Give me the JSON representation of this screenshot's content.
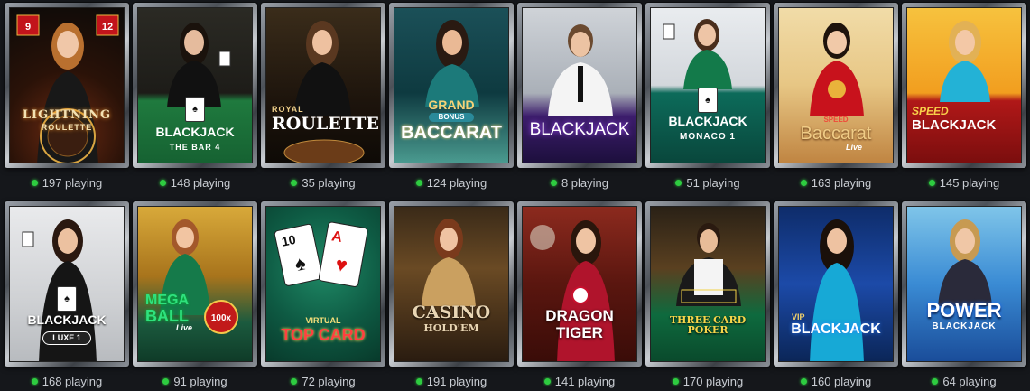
{
  "colors": {
    "page_bg": "#15171b",
    "status_dot": "#2ecc40",
    "count_text": "#c9cdd3"
  },
  "games": [
    {
      "logo": [
        "LIGHTNING",
        "ROULETTE",
        ""
      ],
      "playing": "197 playing",
      "theme": "lightning"
    },
    {
      "logo": [
        "BLACKJACK",
        "THE BAR 4",
        ""
      ],
      "playing": "148 playing",
      "theme": "bar4"
    },
    {
      "logo": [
        "ROYAL",
        "ROULETTE",
        ""
      ],
      "playing": "35 playing",
      "theme": "royal"
    },
    {
      "logo": [
        "GRAND",
        "BONUS",
        "BACCARAT"
      ],
      "playing": "124 playing",
      "theme": "grand"
    },
    {
      "logo": [
        "BLACKJACK",
        "",
        ""
      ],
      "playing": "8 playing",
      "theme": "infinite"
    },
    {
      "logo": [
        "BLACKJACK",
        "MONACO 1",
        ""
      ],
      "playing": "51 playing",
      "theme": "monaco"
    },
    {
      "logo": [
        "SPEED",
        "Baccarat",
        "Live"
      ],
      "playing": "163 playing",
      "theme": "speedbac"
    },
    {
      "logo": [
        "SPEED",
        "BLACKJACK",
        ""
      ],
      "playing": "145 playing",
      "theme": "speedbj"
    },
    {
      "logo": [
        "BLACKJACK",
        "LUXE 1",
        ""
      ],
      "playing": "168 playing",
      "theme": "luxe"
    },
    {
      "logo": [
        "MEGA",
        "BALL",
        "Live"
      ],
      "playing": "91 playing",
      "theme": "megaball"
    },
    {
      "logo": [
        "VIRTUAL",
        "TOP CARD",
        ""
      ],
      "playing": "72 playing",
      "theme": "topcard"
    },
    {
      "logo": [
        "CASINO",
        "HOLD'EM",
        ""
      ],
      "playing": "191 playing",
      "theme": "holdem"
    },
    {
      "logo": [
        "DRAGON",
        "TIGER",
        ""
      ],
      "playing": "141 playing",
      "theme": "dragon"
    },
    {
      "logo": [
        "THREE CARD POKER",
        "",
        ""
      ],
      "playing": "170 playing",
      "theme": "threecard"
    },
    {
      "logo": [
        "VIP",
        "BLACKJACK",
        ""
      ],
      "playing": "160 playing",
      "theme": "vip"
    },
    {
      "logo": [
        "POWER",
        "BLACKJACK",
        ""
      ],
      "playing": "64 playing",
      "theme": "power"
    }
  ]
}
